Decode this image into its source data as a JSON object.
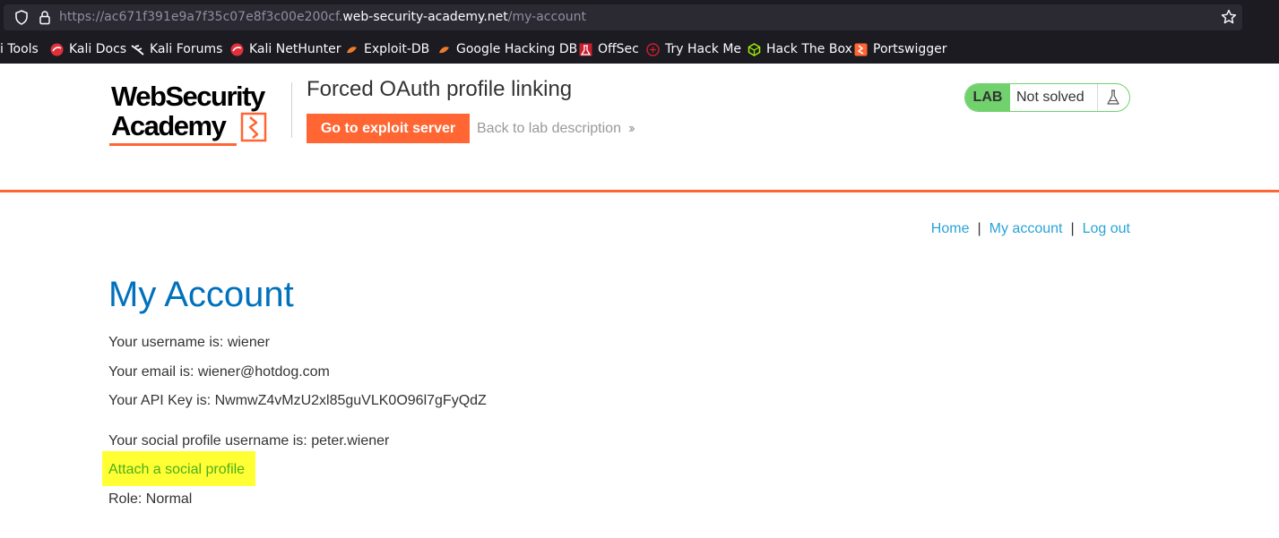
{
  "browser": {
    "url_prefix": "https://ac671f391e9a7f35c07e8f3c00e200cf.",
    "url_host": "web-security-academy.net",
    "url_path": "/my-account",
    "bookmarks": [
      {
        "label": "i Tools",
        "icon": "none"
      },
      {
        "label": "Kali Docs",
        "icon": "kali-icon"
      },
      {
        "label": "Kali Forums",
        "icon": "kali-dragon-icon"
      },
      {
        "label": "Kali NetHunter",
        "icon": "kali-icon"
      },
      {
        "label": "Exploit-DB",
        "icon": "exploitdb-icon"
      },
      {
        "label": "Google Hacking DB",
        "icon": "exploitdb-icon"
      },
      {
        "label": "OffSec",
        "icon": "offsec-icon"
      },
      {
        "label": "Try Hack Me",
        "icon": "tryhackme-icon"
      },
      {
        "label": "Hack The Box",
        "icon": "hackthebox-icon"
      },
      {
        "label": "Portswigger",
        "icon": "portswigger-icon"
      }
    ]
  },
  "header": {
    "logo_line1": "WebSecurity",
    "logo_line2": "Academy",
    "lab_title": "Forced OAuth profile linking",
    "exploit_button": "Go to exploit server",
    "back_link": "Back to lab description",
    "lab_badge": "LAB",
    "lab_status": "Not solved"
  },
  "nav": {
    "home": "Home",
    "my_account": "My account",
    "log_out": "Log out",
    "separator": "|"
  },
  "main": {
    "title": "My Account",
    "username_line": "Your username is: wiener",
    "email_line": "Your email is: wiener@hotdog.com",
    "api_key_line": "Your API Key is: NwmwZ4vMzU2xl85guVLK0O96l7gFyQdZ",
    "social_line": "Your social profile username is: peter.wiener",
    "attach_link": "Attach a social profile",
    "role_line": "Role: Normal"
  },
  "colors": {
    "brand_orange": "#ff6633",
    "title_blue": "#0071bc",
    "link_blue": "#29a3d8",
    "lab_green": "#70d16d",
    "highlight_yellow": "#ffff33"
  }
}
